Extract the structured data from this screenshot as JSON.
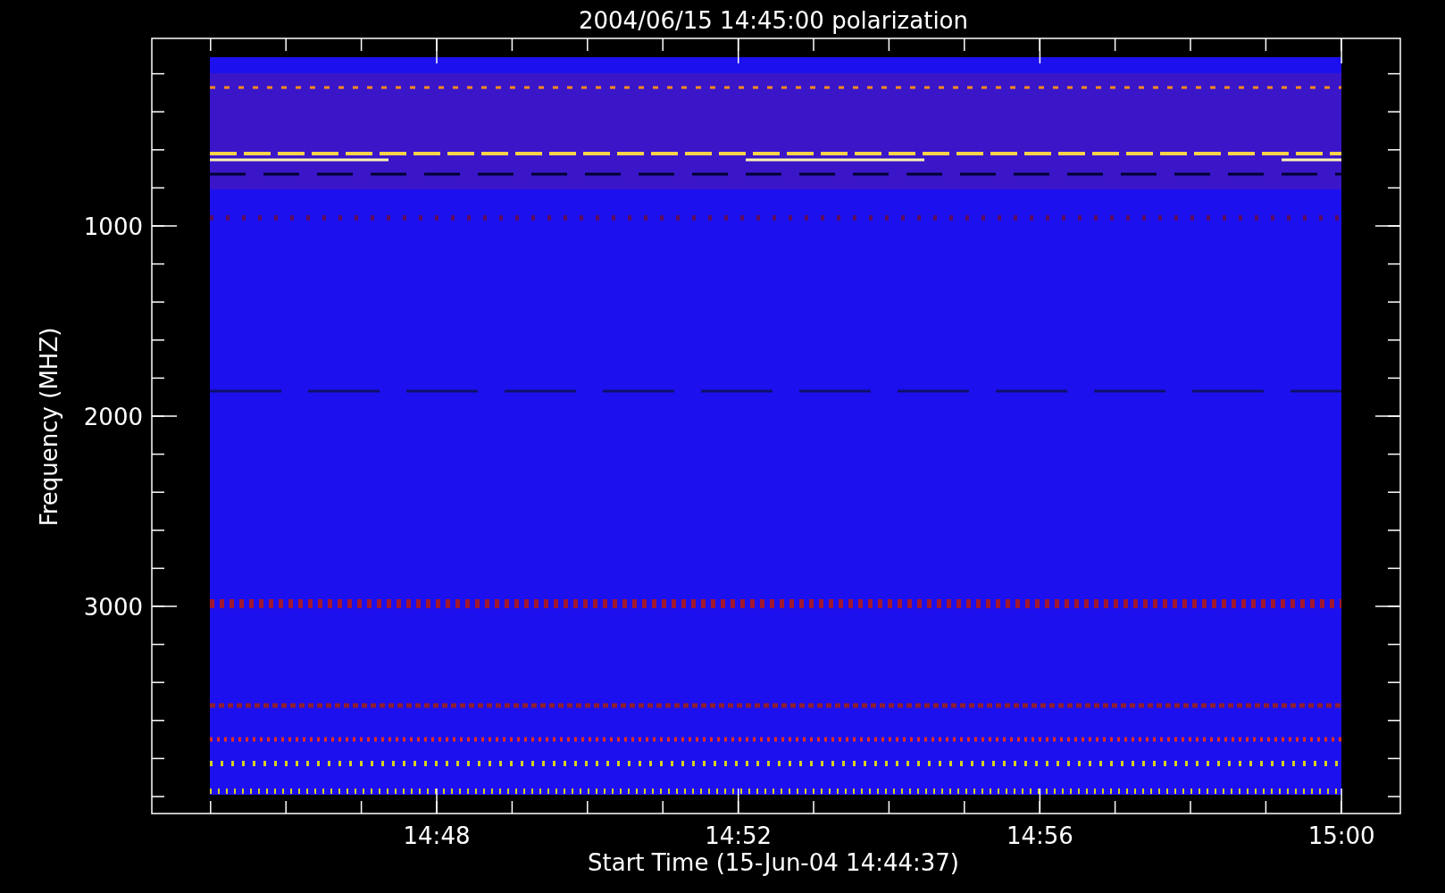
{
  "title": "2004/06/15 14:45:00 polarization",
  "y_axis": {
    "label": "Frequency (MHZ)",
    "ticks": [
      "1000",
      "2000",
      "3000"
    ]
  },
  "x_axis": {
    "label": "Start Time (15-Jun-04 14:44:37)",
    "ticks": [
      "14:48",
      "14:52",
      "14:56",
      "15:00"
    ]
  }
}
